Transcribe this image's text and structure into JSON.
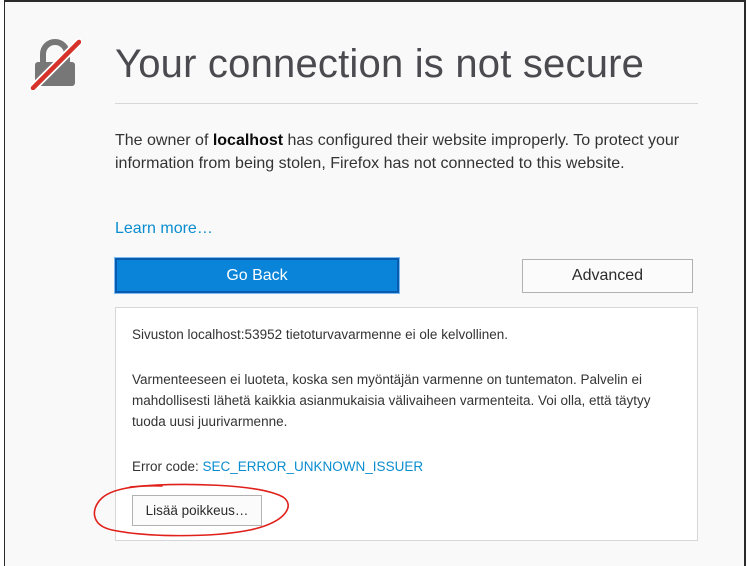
{
  "page": {
    "title": "Your connection is not secure",
    "intro_before": "The owner of ",
    "intro_host": "localhost",
    "intro_after": " has configured their website improperly. To protect your information from being stolen, Firefox has not connected to this website.",
    "learn_more": "Learn more…"
  },
  "buttons": {
    "go_back": "Go Back",
    "advanced": "Advanced",
    "add_exception": "Lisää poikkeus…"
  },
  "advanced_panel": {
    "line1": "Sivuston localhost:53952 tietoturvavarmenne ei ole kelvollinen.",
    "line2": "Varmenteeseen ei luoteta, koska sen myöntäjän varmenne on tuntematon. Palvelin ei mahdollisesti lähetä kaikkia asianmukaisia välivaiheen varmenteita. Voi olla, että täytyy tuoda uusi juurivarmenne.",
    "error_label": "Error code: ",
    "error_code": "SEC_ERROR_UNKNOWN_ISSUER"
  },
  "colors": {
    "accent": "#0a84d8",
    "link": "#0a8dcf",
    "annotation": "#e0201a",
    "lock_slash": "#d6322a"
  },
  "icons": {
    "header": "broken-lock-icon"
  }
}
